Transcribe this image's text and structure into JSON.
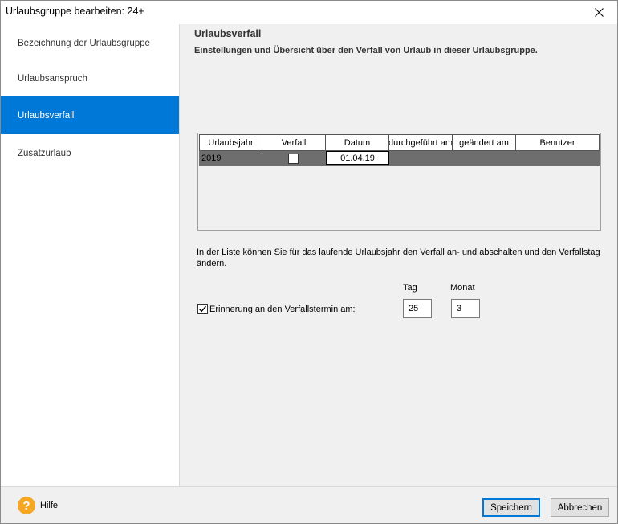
{
  "window": {
    "title": "Urlaubsgruppe bearbeiten: 24+"
  },
  "sidebar": {
    "items": [
      {
        "label": "Bezeichnung der Urlaubsgruppe",
        "active": false
      },
      {
        "label": "Urlaubsanspruch",
        "active": false
      },
      {
        "label": "Urlaubsverfall",
        "active": true
      },
      {
        "label": "Zusatzurlaub",
        "active": false
      }
    ]
  },
  "main": {
    "title": "Urlaubsverfall",
    "description": "Einstellungen und Übersicht über den Verfall von Urlaub in dieser Urlaubsgruppe.",
    "table": {
      "columns": [
        "Urlaubsjahr",
        "Verfall",
        "Datum",
        "durchgeführt am",
        "geändert am",
        "Benutzer"
      ],
      "rows": [
        {
          "year": "2019",
          "verfall": false,
          "date": "01.04.19",
          "durchgefuehrt": "",
          "geaendert": "",
          "benutzer": ""
        }
      ]
    },
    "info": "In der Liste können Sie für das laufende Urlaubsjahr den Verfall an- und abschalten und den Verfallstag ändern.",
    "reminder": {
      "label": "Erinnerung an den Verfallstermin am:",
      "checked": true,
      "tag_label": "Tag",
      "tag_value": "25",
      "monat_label": "Monat",
      "monat_value": "3"
    }
  },
  "footer": {
    "help_label": "Hilfe",
    "save_label": "Speichern",
    "cancel_label": "Abbrechen"
  },
  "colors": {
    "accent": "#0078d7",
    "help": "#f5a623",
    "selected_row": "#6e6e6e"
  }
}
